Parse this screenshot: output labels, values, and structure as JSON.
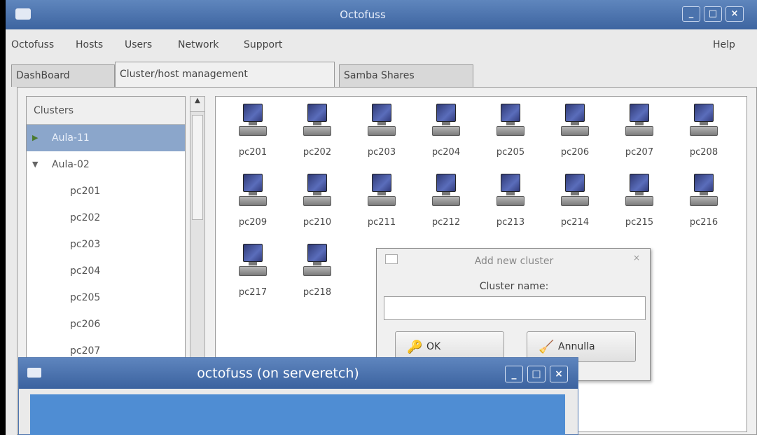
{
  "window": {
    "title": "Octofuss",
    "minimize": "_",
    "maximize": "□",
    "close": "×"
  },
  "menu": {
    "items": [
      "Octofuss",
      "Hosts",
      "Users",
      "Network",
      "Support"
    ],
    "help": "Help"
  },
  "tabs": [
    {
      "label": "DashBoard",
      "active": false
    },
    {
      "label": "Cluster/host management",
      "active": true
    },
    {
      "label": "Samba Shares",
      "active": false
    }
  ],
  "tree": {
    "header": "Clusters",
    "rows": [
      {
        "label": "Aula-11",
        "selected": true,
        "expander": "▶",
        "child": false
      },
      {
        "label": "Aula-02",
        "selected": false,
        "expander": "▼",
        "child": false
      },
      {
        "label": "pc201",
        "selected": false,
        "expander": "",
        "child": true
      },
      {
        "label": "pc202",
        "selected": false,
        "expander": "",
        "child": true
      },
      {
        "label": "pc203",
        "selected": false,
        "expander": "",
        "child": true
      },
      {
        "label": "pc204",
        "selected": false,
        "expander": "",
        "child": true
      },
      {
        "label": "pc205",
        "selected": false,
        "expander": "",
        "child": true
      },
      {
        "label": "pc206",
        "selected": false,
        "expander": "",
        "child": true
      },
      {
        "label": "pc207",
        "selected": false,
        "expander": "",
        "child": true
      }
    ]
  },
  "scroll": {
    "arrow_up": "▲"
  },
  "hosts": [
    "pc201",
    "pc202",
    "pc203",
    "pc204",
    "pc205",
    "pc206",
    "pc207",
    "pc208",
    "pc209",
    "pc210",
    "pc211",
    "pc212",
    "pc213",
    "pc214",
    "pc215",
    "pc216",
    "pc217",
    "pc218"
  ],
  "add_cluster_dialog": {
    "title": "Add new cluster",
    "close": "×",
    "field_label": "Cluster name:",
    "field_value": "",
    "ok_label": "OK",
    "ok_icon": "🔑",
    "cancel_label": "Annulla",
    "cancel_icon": "🧹"
  },
  "octofuss_dialog": {
    "title": "octofuss (on serveretch)",
    "minimize": "_",
    "maximize": "□",
    "close": "×"
  },
  "colors": {
    "titlebar": "#4a71aa",
    "selection": "#8ba6cb",
    "content_blue": "#4f8dd3"
  }
}
